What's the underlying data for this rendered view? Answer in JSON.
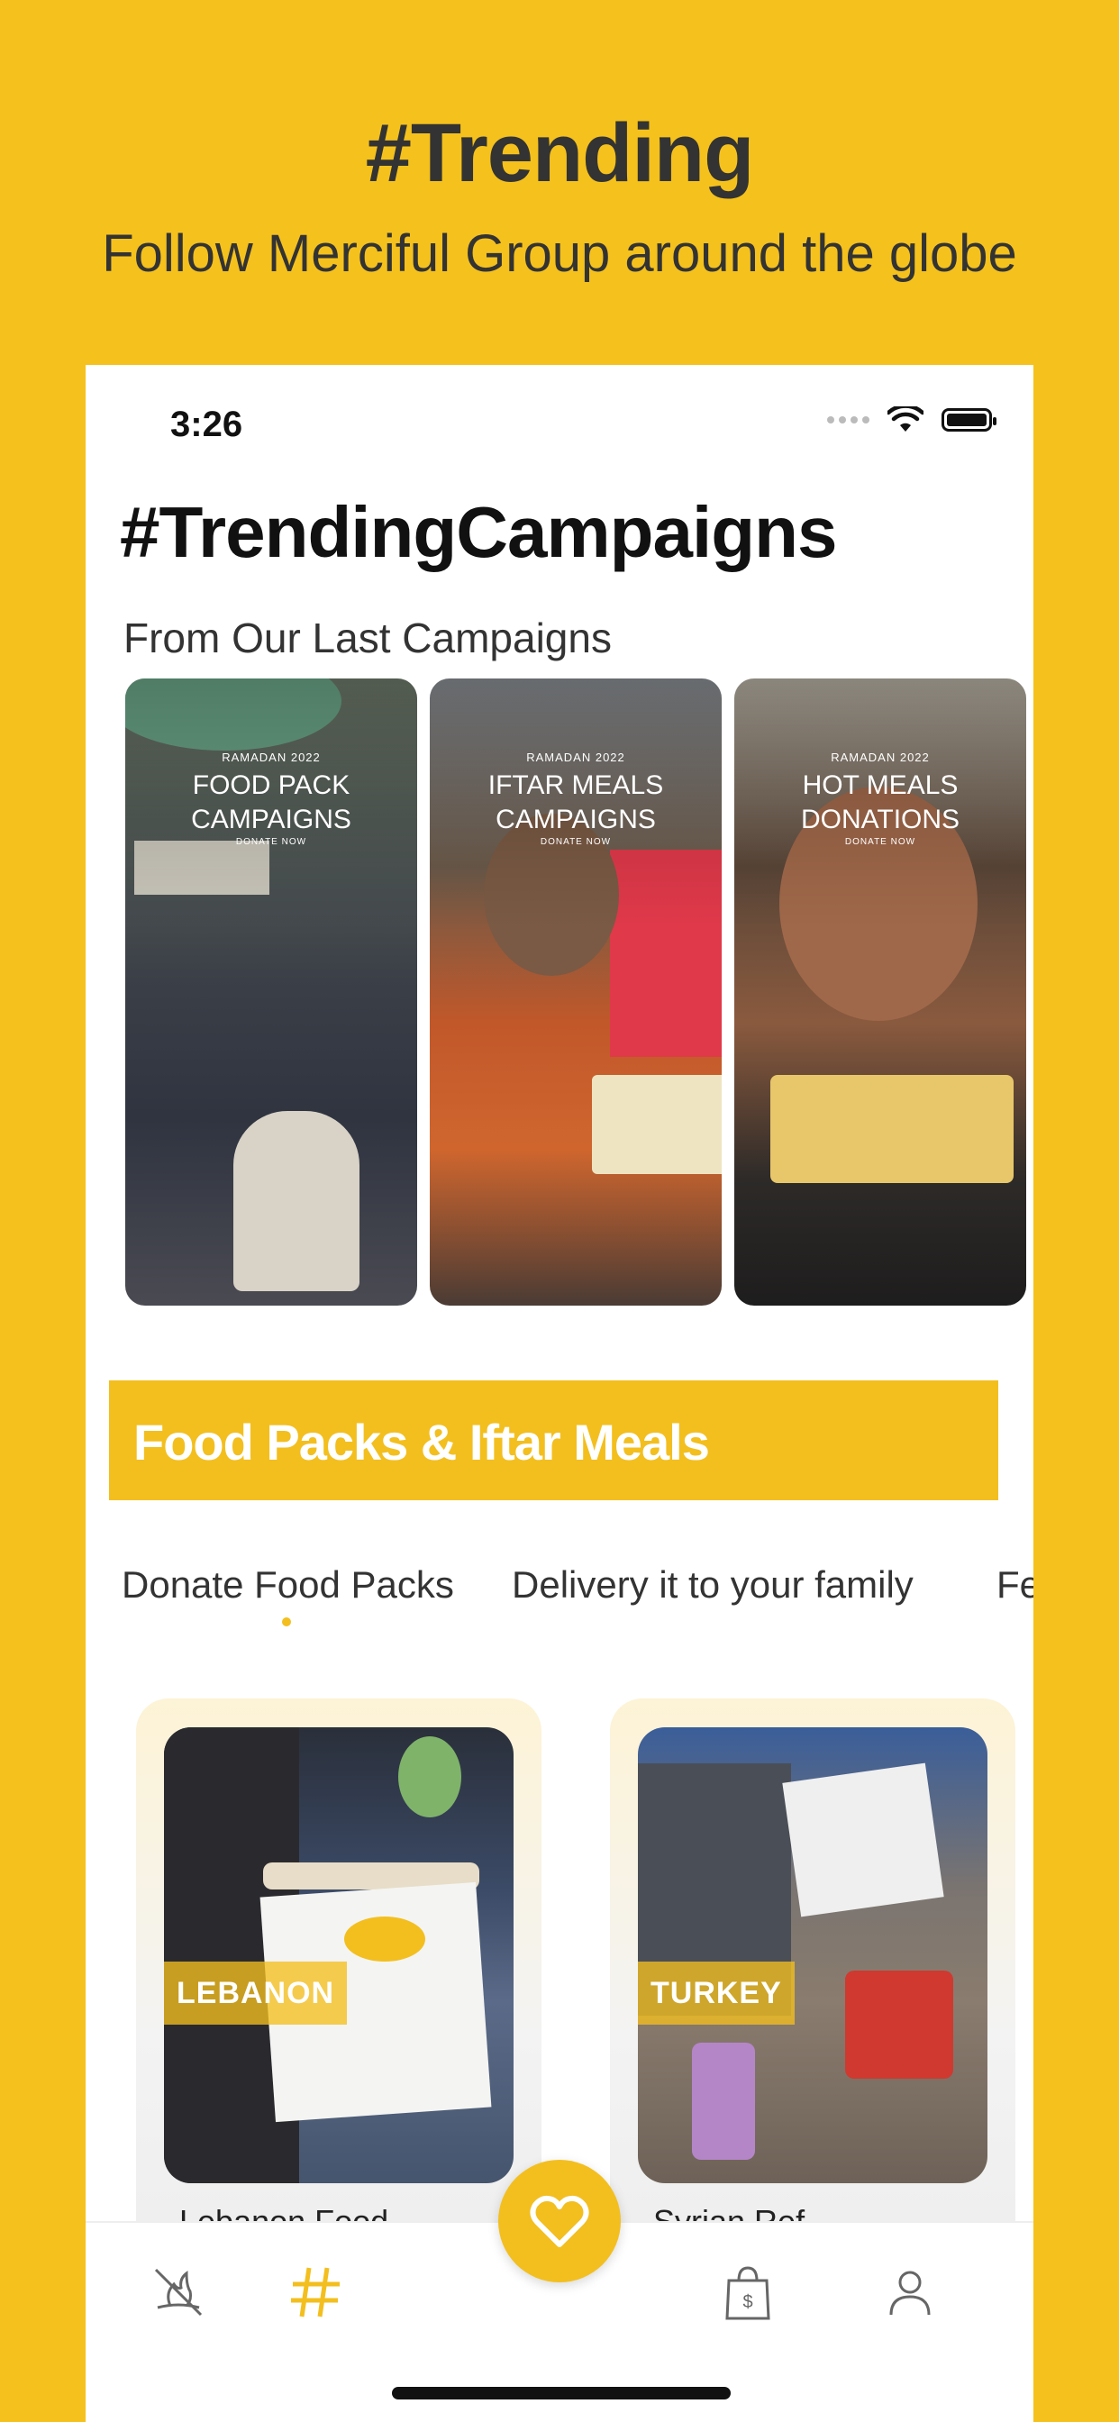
{
  "promo": {
    "title": "#Trending",
    "subtitle": "Follow Merciful Group around the globe"
  },
  "status_bar": {
    "time": "3:26"
  },
  "page": {
    "title": "#TrendingCampaigns",
    "subtitle": "From Our Last Campaigns"
  },
  "campaigns": [
    {
      "year": "RAMADAN 2022",
      "title_line1": "FOOD PACK",
      "title_line2": "CAMPAIGNS",
      "cta": "DONATE NOW"
    },
    {
      "year": "RAMADAN 2022",
      "title_line1": "IFTAR MEALS",
      "title_line2": "CAMPAIGNS",
      "cta": "DONATE NOW"
    },
    {
      "year": "RAMADAN 2022",
      "title_line1": "HOT MEALS",
      "title_line2": "DONATIONS",
      "cta": "DONATE NOW"
    }
  ],
  "category": {
    "title": "Food Packs & Iftar Meals"
  },
  "tabs": [
    "Donate Food Packs",
    "Delivery it to your family",
    "Fe"
  ],
  "products": [
    {
      "country": "LEBANON",
      "caption": "Lebanon Food"
    },
    {
      "country": "TURKEY",
      "caption": "Syrian Ref"
    }
  ],
  "nav": {
    "items": [
      "campaigns-icon",
      "hashtag-icon",
      "donate-heart-icon",
      "shopping-bag-icon",
      "profile-icon"
    ]
  },
  "colors": {
    "brand_yellow": "#f5c11c",
    "text_dark": "#333333"
  }
}
